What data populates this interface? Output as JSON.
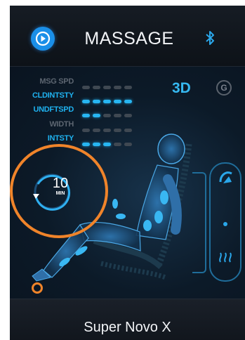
{
  "header": {
    "title": "MASSAGE",
    "play_icon": "play-circle-icon",
    "bluetooth_icon": "bluetooth-icon"
  },
  "settings": [
    {
      "label": "MSG SPD",
      "level": 0,
      "max": 5,
      "active": false
    },
    {
      "label": "CLDINTSTY",
      "level": 5,
      "max": 5,
      "active": true
    },
    {
      "label": "UNDFTSPD",
      "level": 2,
      "max": 5,
      "active": true
    },
    {
      "label": "WIDTH",
      "level": 0,
      "max": 5,
      "active": false
    },
    {
      "label": "INTSTY",
      "level": 3,
      "max": 5,
      "active": true
    }
  ],
  "mode_badge": "3D",
  "g_badge": "G",
  "timer": {
    "value": "10",
    "unit": "MIN"
  },
  "footer": {
    "model": "Super Novo X"
  },
  "colors": {
    "accent": "#27b6f2",
    "highlight": "#f0842a",
    "background": "#0f141c"
  }
}
